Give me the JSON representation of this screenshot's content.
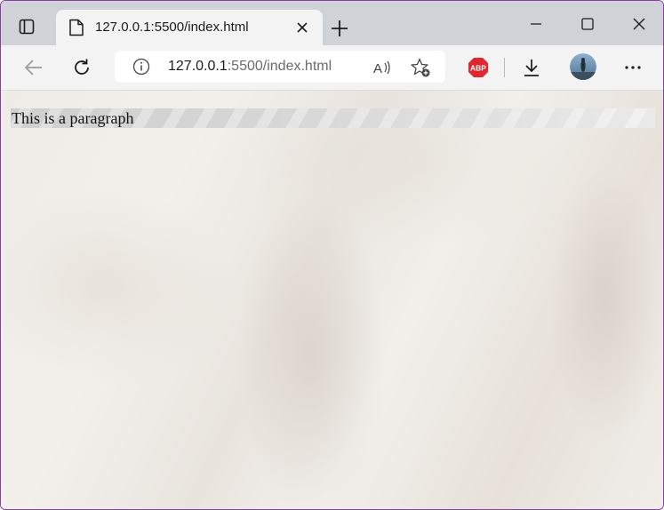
{
  "tab": {
    "title": "127.0.0.1:5500/index.html"
  },
  "address_bar": {
    "host": "127.0.0.1",
    "path": ":5500/index.html"
  },
  "toolbar": {
    "abp_label": "ABP"
  },
  "content": {
    "paragraph": "This is a paragraph"
  },
  "colors": {
    "abp_red": "#e0262e",
    "tab_strip": "#cfd2d6",
    "window_border": "#8a3ea0"
  }
}
